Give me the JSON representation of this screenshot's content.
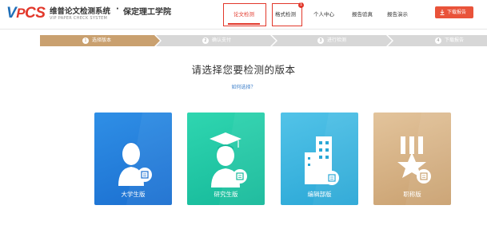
{
  "header": {
    "logo": {
      "v": "V",
      "p": "P",
      "cs": "CS"
    },
    "brand_name": "维普论文检测系统",
    "brand_sub": "VIP PAPER CHECK SYSTEM",
    "dot": "·",
    "school": "保定理工学院",
    "nav": [
      {
        "label": "论文检测",
        "active": true
      },
      {
        "label": "格式检测",
        "active": false,
        "badge": "1"
      },
      {
        "label": "个人中心",
        "active": false
      },
      {
        "label": "报告验真",
        "active": false
      },
      {
        "label": "报告演示",
        "active": false
      }
    ],
    "download_label": "下载报告",
    "accent_color": "#e2382b"
  },
  "steps": [
    {
      "num": "1",
      "label": "选择版本",
      "active": true
    },
    {
      "num": "2",
      "label": "确认支付",
      "active": false
    },
    {
      "num": "3",
      "label": "进行检测",
      "active": false
    },
    {
      "num": "4",
      "label": "下载报告",
      "active": false
    }
  ],
  "step_colors": {
    "active": "#c9a06f",
    "inactive": "#d7d7d7"
  },
  "main": {
    "title": "请选择您要检测的版本",
    "how_link": "如何选择？"
  },
  "cards": [
    {
      "label": "大学生版",
      "color_top": "#2f8fe6",
      "color_bottom": "#1b6fd0",
      "icon": "student-icon"
    },
    {
      "label": "研究生版",
      "color_top": "#2fd6b0",
      "color_bottom": "#16b99a",
      "icon": "graduate-icon"
    },
    {
      "label": "编辑部版",
      "color_top": "#52c3e8",
      "color_bottom": "#2aa7d6",
      "icon": "building-icon"
    },
    {
      "label": "职称版",
      "color_top": "#e3c49c",
      "color_bottom": "#c9a06f",
      "icon": "star-award-icon"
    }
  ]
}
